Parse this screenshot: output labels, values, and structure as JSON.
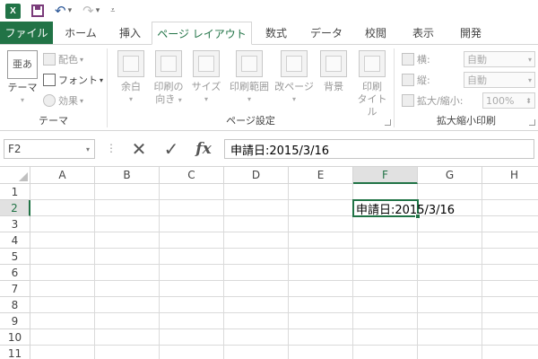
{
  "app": {
    "logo_label": "X",
    "accent": "#217346"
  },
  "qat": {
    "undo_icon": "undo-icon",
    "redo_icon": "redo-icon",
    "save_icon": "save-icon"
  },
  "tabs": [
    {
      "label": "ファイル"
    },
    {
      "label": "ホーム"
    },
    {
      "label": "挿入"
    },
    {
      "label": "ページ レイアウト"
    },
    {
      "label": "数式"
    },
    {
      "label": "データ"
    },
    {
      "label": "校閲"
    },
    {
      "label": "表示"
    },
    {
      "label": "開発"
    }
  ],
  "ribbon": {
    "theme_group": {
      "label": "テーマ",
      "theme_btn": "テーマ",
      "theme_icon_text": "亜あ",
      "colors": "配色",
      "fonts": "フォント",
      "effects": "効果"
    },
    "page_setup_group": {
      "label": "ページ設定",
      "margins": "余白",
      "orientation_line1": "印刷の",
      "orientation_line2": "向き",
      "size": "サイズ",
      "print_area": "印刷範囲",
      "breaks": "改ページ",
      "background": "背景",
      "print_titles_line1": "印刷",
      "print_titles_line2": "タイトル"
    },
    "scale_group": {
      "label": "拡大縮小印刷",
      "width_label": "横:",
      "width_value": "自動",
      "height_label": "縦:",
      "height_value": "自動",
      "scale_label": "拡大/縮小:",
      "scale_value": "100%"
    }
  },
  "formula_bar": {
    "name_box": "F2",
    "cancel_symbol": "✕",
    "enter_symbol": "✓",
    "fx_label": "fx",
    "content": "申請日:2015/3/16"
  },
  "sheet": {
    "columns": [
      "A",
      "B",
      "C",
      "D",
      "E",
      "F",
      "G",
      "H"
    ],
    "rows": [
      "1",
      "2",
      "3",
      "4",
      "5",
      "6",
      "7",
      "8",
      "9",
      "10",
      "11"
    ],
    "selected_column": "F",
    "selected_row": "2",
    "cell_F2": "申請日:2015/3/16"
  }
}
